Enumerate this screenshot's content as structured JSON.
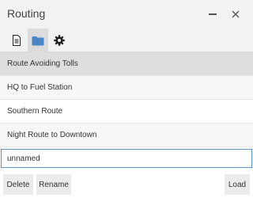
{
  "window": {
    "title": "Routing"
  },
  "icons": {
    "minimize": "minimize-icon",
    "close": "close-icon",
    "tabs": [
      "document-icon",
      "folder-icon",
      "gear-icon"
    ]
  },
  "colors": {
    "selected_row": "#dedede",
    "input_border": "#5a93d6",
    "folder_icon": "#4a86c5"
  },
  "routes": [
    {
      "label": "Route Avoiding Tolls",
      "selected": true
    },
    {
      "label": "HQ to Fuel Station",
      "selected": false
    },
    {
      "label": "Southern Route",
      "selected": false
    },
    {
      "label": "Night Route to Downtown",
      "selected": false
    }
  ],
  "name_input": {
    "value": "unnamed"
  },
  "buttons": {
    "delete": "Delete",
    "rename": "Rename",
    "load": "Load"
  }
}
